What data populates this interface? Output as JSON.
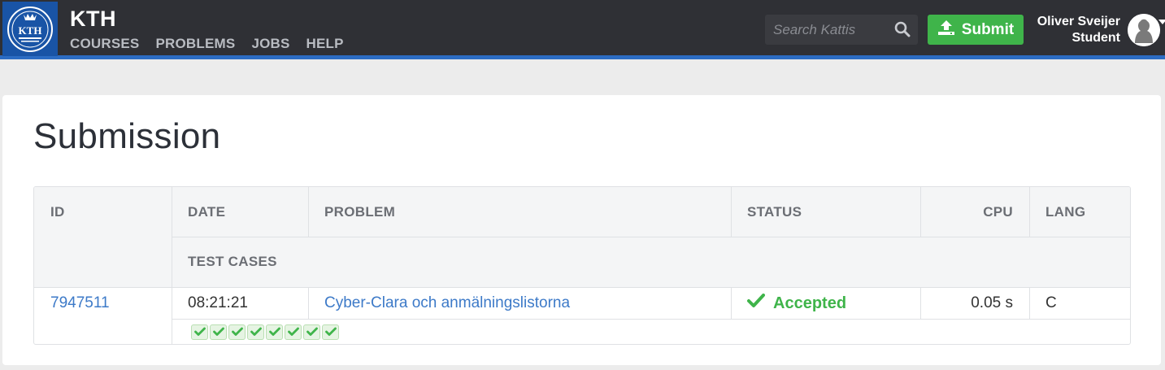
{
  "header": {
    "brand": "KTH",
    "logo_text": "KTH",
    "nav": [
      "COURSES",
      "PROBLEMS",
      "JOBS",
      "HELP"
    ],
    "search_placeholder": "Search Kattis",
    "submit_label": "Submit",
    "user_name": "Oliver Sveijer",
    "user_role": "Student"
  },
  "page_title": "Submission",
  "table": {
    "headers": {
      "id": "ID",
      "date": "DATE",
      "problem": "PROBLEM",
      "status": "STATUS",
      "cpu": "CPU",
      "lang": "LANG",
      "test_cases": "TEST CASES"
    },
    "row": {
      "id": "7947511",
      "date": "08:21:21",
      "problem": "Cyber-Clara och anmälningslistorna",
      "status": "Accepted",
      "cpu": "0.05 s",
      "lang": "C",
      "test_cases_passed": 8
    }
  },
  "colors": {
    "topbar": "#2f3035",
    "accent_blue": "#2c6cc3",
    "accepted_green": "#3fb44a",
    "link_blue": "#3d7ac8"
  }
}
